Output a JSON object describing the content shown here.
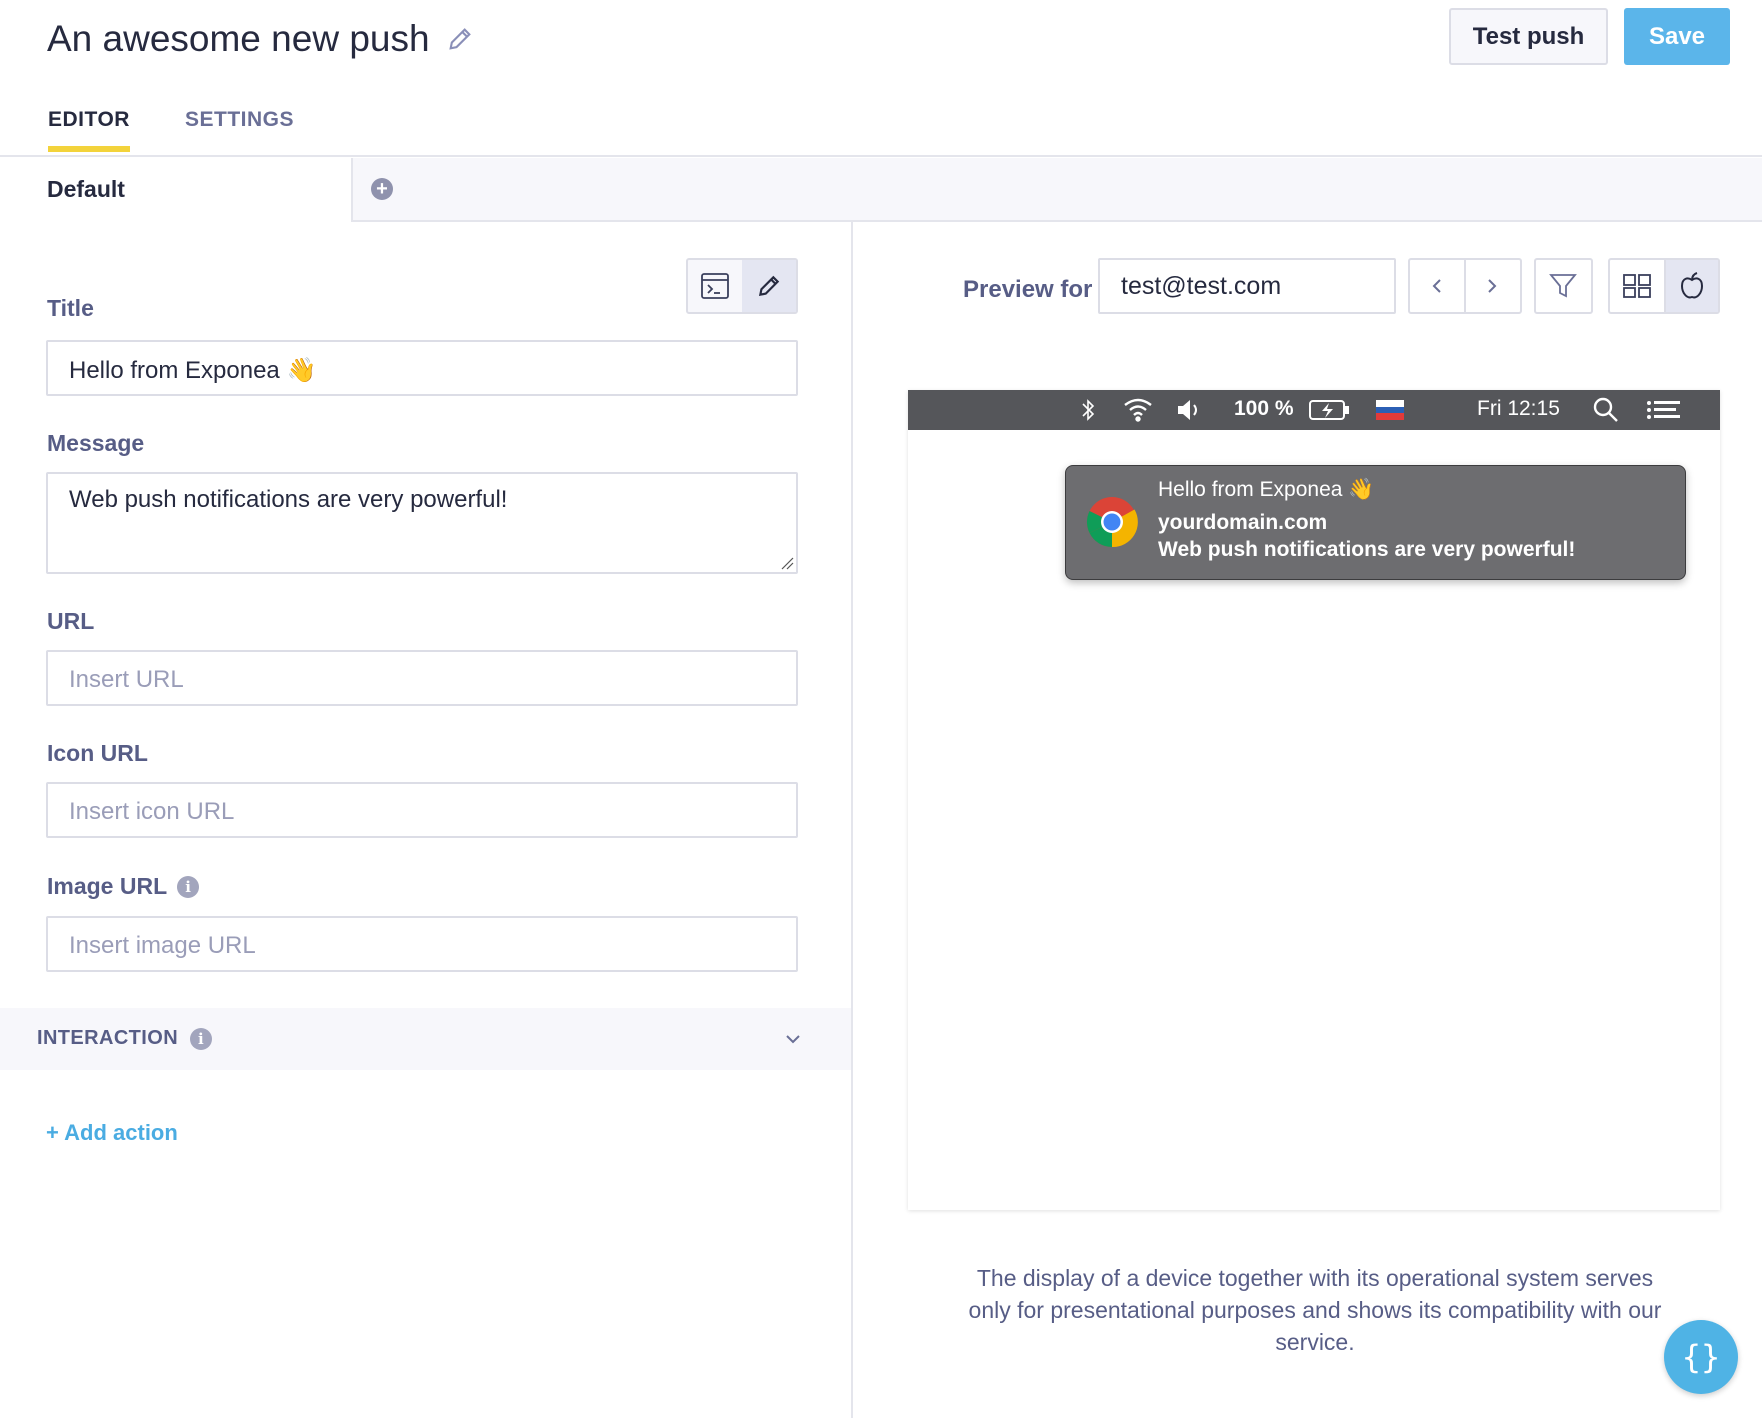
{
  "header": {
    "title": "An awesome new push",
    "test_push_label": "Test push",
    "save_label": "Save"
  },
  "tabs": [
    {
      "label": "EDITOR",
      "active": true
    },
    {
      "label": "SETTINGS",
      "active": false
    }
  ],
  "variants": {
    "default_label": "Default"
  },
  "editor": {
    "fields": {
      "title": {
        "label": "Title",
        "value": "Hello from Exponea 👋"
      },
      "message": {
        "label": "Message",
        "value": "Web push notifications are very powerful!"
      },
      "url": {
        "label": "URL",
        "placeholder": "Insert URL"
      },
      "icon_url": {
        "label": "Icon URL",
        "placeholder": "Insert icon URL"
      },
      "image_url": {
        "label": "Image URL",
        "placeholder": "Insert image URL"
      }
    },
    "interaction_label": "INTERACTION",
    "add_action_label": "+ Add action"
  },
  "preview": {
    "label": "Preview for",
    "customer": "test@test.com",
    "menubar": {
      "battery": "100 %",
      "time": "Fri 12:15"
    },
    "notification": {
      "title": "Hello from Exponea 👋",
      "domain": "yourdomain.com",
      "message": "Web push notifications are very powerful!"
    },
    "disclaimer": "The display of a device together with its operational system serves only for presentational purposes and shows its compatibility with our service."
  },
  "colors": {
    "accent": "#5bb5ea",
    "tab_underline": "#f3d33b",
    "link": "#4aace2"
  },
  "icons": [
    "pencil-icon",
    "plus-circle-icon",
    "code-view-icon",
    "edit-icon",
    "info-icon",
    "chevron-down-icon",
    "chevron-left-icon",
    "chevron-right-icon",
    "filter-icon",
    "windows-icon",
    "apple-icon",
    "bluetooth-icon",
    "wifi-icon",
    "volume-icon",
    "battery-icon",
    "flag-icon",
    "search-icon",
    "menu-list-icon",
    "chrome-icon",
    "code-braces-icon"
  ]
}
